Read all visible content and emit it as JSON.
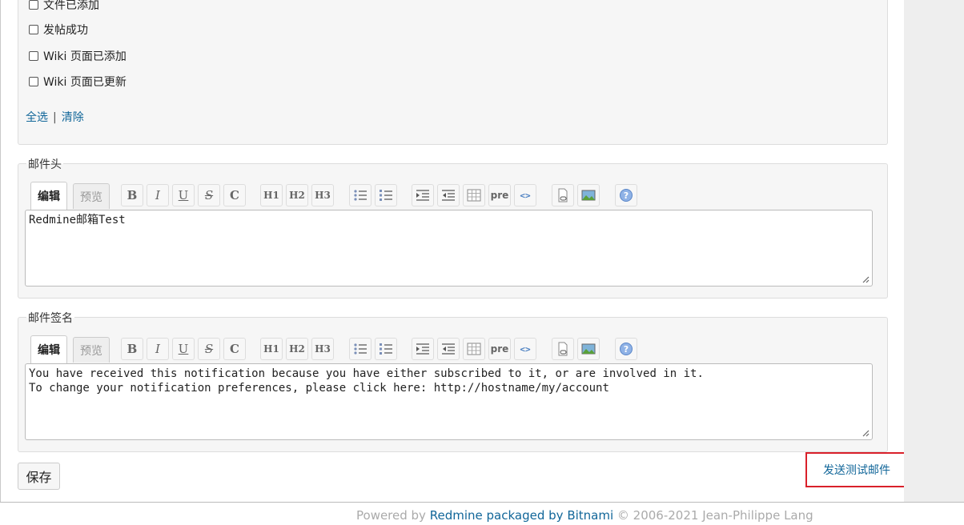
{
  "notifications": {
    "items": [
      {
        "label": "文件已添加",
        "checked": false
      },
      {
        "label": "发帖成功",
        "checked": false
      },
      {
        "label": "Wiki 页面已添加",
        "checked": false
      },
      {
        "label": "Wiki 页面已更新",
        "checked": false
      }
    ],
    "select_all": "全选",
    "separator": "|",
    "clear": "清除"
  },
  "header_editor": {
    "legend": "邮件头",
    "tab_edit": "编辑",
    "tab_preview": "预览",
    "content": "Redmine邮箱Test"
  },
  "signature_editor": {
    "legend": "邮件签名",
    "tab_edit": "编辑",
    "tab_preview": "预览",
    "content": "You have received this notification because you have either subscribed to it, or are involved in it.\nTo change your notification preferences, please click here: http://hostname/my/account"
  },
  "toolbar": {
    "bold": "B",
    "italic": "I",
    "underline": "U",
    "strike": "S",
    "code": "C",
    "h1": "H1",
    "h2": "H2",
    "h3": "H3",
    "pre": "pre",
    "inline_code": "<>"
  },
  "actions": {
    "save": "保存",
    "send_test_mail": "发送测试邮件"
  },
  "footer": {
    "powered_by": "Powered by",
    "redmine": "Redmine",
    "packaged_by": " packaged by ",
    "bitnami": "Bitnami",
    "copyright": " © 2006-2021 Jean-Philippe Lang"
  },
  "colors": {
    "link": "#116699",
    "highlight": "#d9202a"
  }
}
